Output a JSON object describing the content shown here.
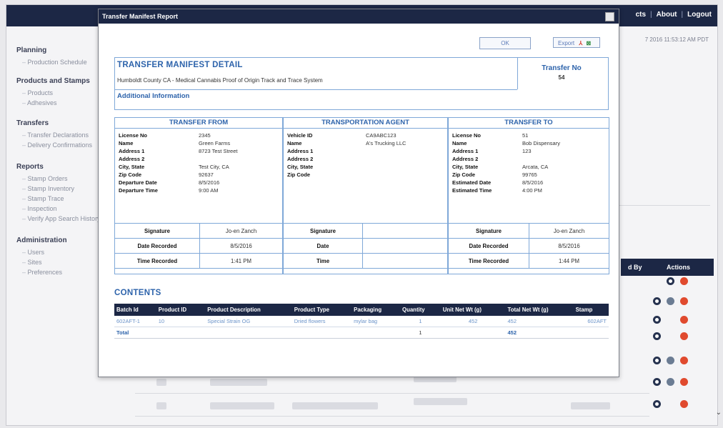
{
  "topnav": {
    "items": [
      "cts",
      "About",
      "Logout"
    ]
  },
  "timestamp": "7 2016 11:53:12 AM PDT",
  "sidebar": [
    {
      "heading": "Planning",
      "items": [
        "Production Schedule"
      ]
    },
    {
      "heading": "Products and Stamps",
      "items": [
        "Products",
        "Adhesives"
      ]
    },
    {
      "heading": "Transfers",
      "items": [
        "Transfer Declarations",
        "Delivery Confirmations"
      ]
    },
    {
      "heading": "Reports",
      "items": [
        "Stamp Orders",
        "Stamp Inventory",
        "Stamp Trace",
        "Inspection",
        "Verify App Search History"
      ]
    },
    {
      "heading": "Administration",
      "items": [
        "Users",
        "Sites",
        "Preferences"
      ]
    }
  ],
  "bg_table": {
    "col1": "d By",
    "col2": "Actions"
  },
  "modal": {
    "title": "Transfer Manifest Report",
    "ok_label": "OK",
    "export_label": "Export",
    "pdf_glyph": "⅄",
    "xls_glyph": "⊠",
    "detail_title": "TRANSFER MANIFEST DETAIL",
    "detail_subtitle": "Humboldt County CA - Medical Cannabis Proof of Origin Track and Trace System",
    "additional_info": "Additional Information",
    "transfer_no_label": "Transfer No",
    "transfer_no_value": "54"
  },
  "from": {
    "heading": "TRANSFER FROM",
    "fields": [
      {
        "k": "License No",
        "v": "2345"
      },
      {
        "k": "Name",
        "v": "Green Farms"
      },
      {
        "k": "Address 1",
        "v": "8723 Test Street"
      },
      {
        "k": "Address 2",
        "v": ""
      },
      {
        "k": "City, State",
        "v": "Test City, CA"
      },
      {
        "k": "Zip Code",
        "v": "92637"
      },
      {
        "k": "Departure Date",
        "v": "8/5/2016"
      },
      {
        "k": "Departure Time",
        "v": "9:00 AM"
      }
    ],
    "sig": [
      {
        "k": "Signature",
        "v": "Jo-en Zanch"
      },
      {
        "k": "Date Recorded",
        "v": "8/5/2016"
      },
      {
        "k": "Time Recorded",
        "v": "1:41 PM"
      }
    ]
  },
  "agent": {
    "heading": "TRANSPORTATION AGENT",
    "fields": [
      {
        "k": "Vehicle ID",
        "v": "CA9ABC123"
      },
      {
        "k": "Name",
        "v": "A's Trucking LLC"
      },
      {
        "k": "Address 1",
        "v": ""
      },
      {
        "k": "Address 2",
        "v": ""
      },
      {
        "k": "City, State",
        "v": ""
      },
      {
        "k": "Zip Code",
        "v": ""
      }
    ],
    "sig": [
      {
        "k": "Signature",
        "v": ""
      },
      {
        "k": "Date",
        "v": ""
      },
      {
        "k": "Time",
        "v": ""
      }
    ]
  },
  "to": {
    "heading": "TRANSFER TO",
    "fields": [
      {
        "k": "License No",
        "v": "51"
      },
      {
        "k": "Name",
        "v": "Bob Dispensary"
      },
      {
        "k": "Address 1",
        "v": "123"
      },
      {
        "k": "Address 2",
        "v": ""
      },
      {
        "k": "City, State",
        "v": "Arcata, CA"
      },
      {
        "k": "Zip Code",
        "v": "99765"
      },
      {
        "k": "Estimated Date",
        "v": "8/5/2016"
      },
      {
        "k": "Estimated Time",
        "v": "4:00 PM"
      }
    ],
    "sig": [
      {
        "k": "Signature",
        "v": "Jo-en Zanch"
      },
      {
        "k": "Date Recorded",
        "v": "8/5/2016"
      },
      {
        "k": "Time Recorded",
        "v": "1:44 PM"
      }
    ]
  },
  "contents": {
    "title": "CONTENTS",
    "headers": [
      "Batch Id",
      "Product ID",
      "Product Description",
      "Product Type",
      "Packaging",
      "Quantity",
      "Unit Net Wt (g)",
      "Total Net Wt (g)",
      "Stamp"
    ],
    "rows": [
      [
        "602AFT-1",
        "10",
        "Special Strain OG",
        "Dried flowers",
        "mylar bag",
        "1",
        "452",
        "452",
        "602AFT"
      ]
    ],
    "total": [
      "Total",
      "",
      "",
      "",
      "",
      "1",
      "",
      "452",
      ""
    ]
  }
}
